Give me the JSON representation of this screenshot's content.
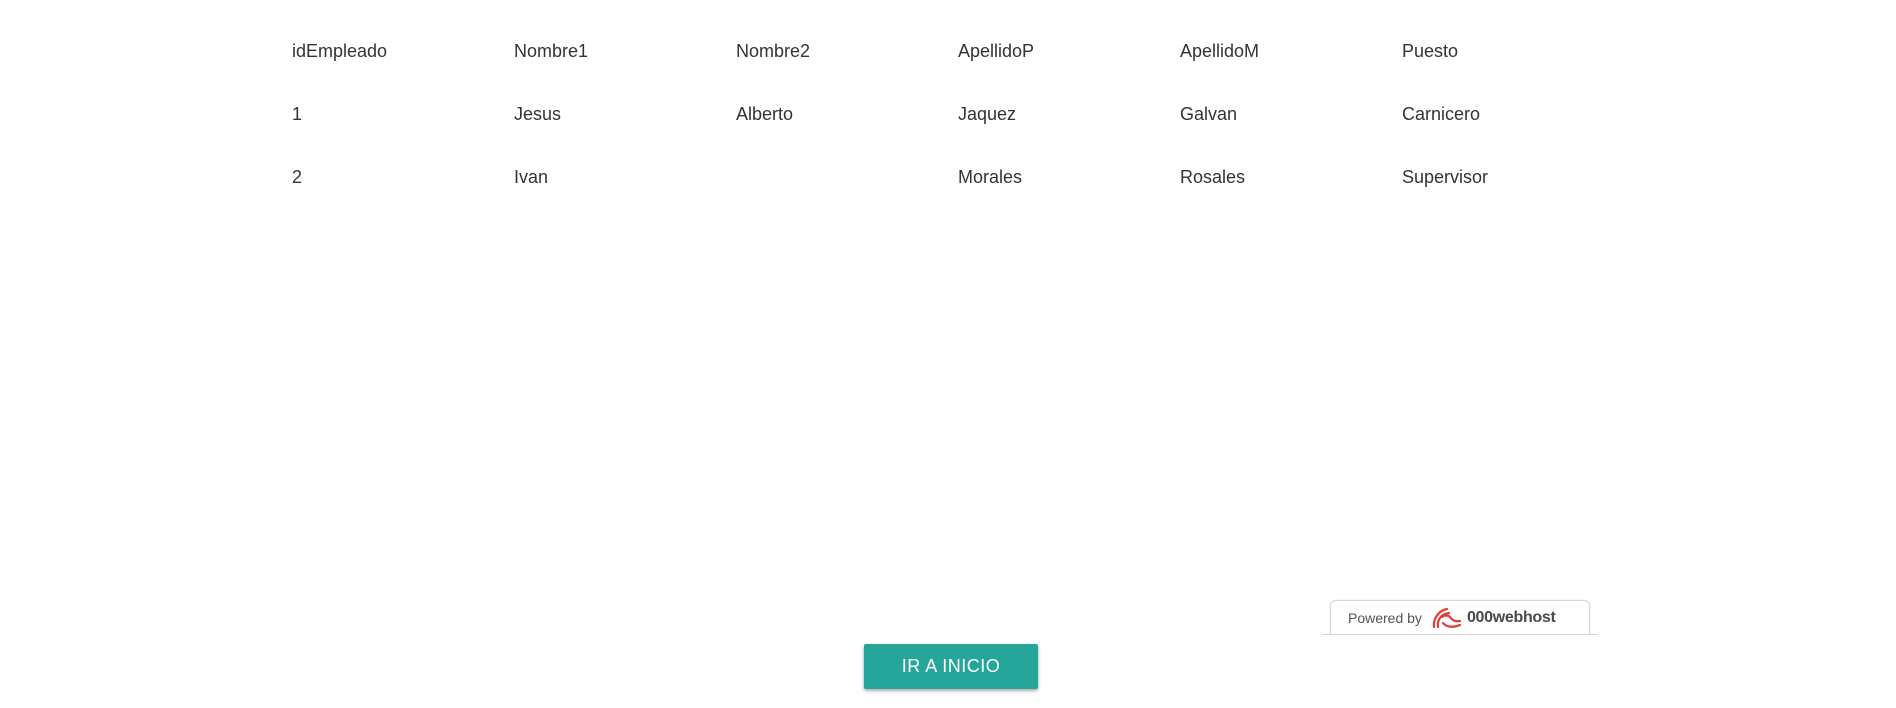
{
  "table": {
    "headers": [
      "idEmpleado",
      "Nombre1",
      "Nombre2",
      "ApellidoP",
      "ApellidoM",
      "Puesto"
    ],
    "rows": [
      [
        "1",
        "Jesus",
        "Alberto",
        "Jaquez",
        "Galvan",
        "Carnicero"
      ],
      [
        "2",
        "Ivan",
        "",
        "Morales",
        "Rosales",
        "Supervisor"
      ]
    ]
  },
  "badge": {
    "powered_by": "Powered by",
    "brand": "000webhost",
    "logo_icon": "000webhost-logo-icon",
    "logo_color": "#e33a3a"
  },
  "button": {
    "label": "IR A INICIO",
    "color": "#26a69a"
  }
}
